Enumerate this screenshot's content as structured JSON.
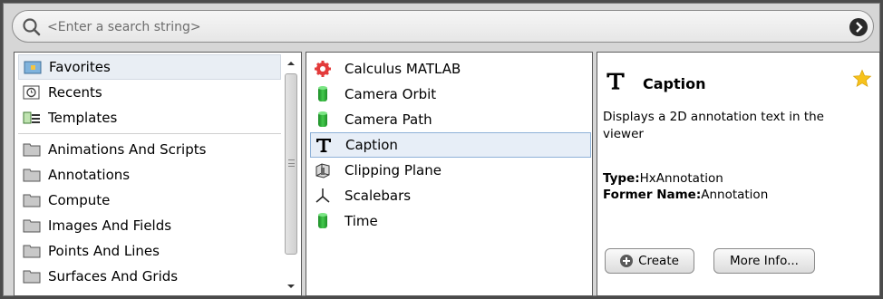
{
  "search": {
    "placeholder": "<Enter a search string>"
  },
  "categories": {
    "top": [
      {
        "label": "Favorites",
        "icon": "favorites-folder-icon"
      },
      {
        "label": "Recents",
        "icon": "recents-clock-icon"
      },
      {
        "label": "Templates",
        "icon": "templates-icon"
      }
    ],
    "folders": [
      {
        "label": "Animations And Scripts"
      },
      {
        "label": "Annotations"
      },
      {
        "label": "Compute"
      },
      {
        "label": "Images And Fields"
      },
      {
        "label": "Points And Lines"
      },
      {
        "label": "Surfaces And Grids"
      }
    ],
    "selected": "Favorites"
  },
  "modules": {
    "items": [
      {
        "label": "Calculus MATLAB",
        "icon": "matlab-gear-icon"
      },
      {
        "label": "Camera Orbit",
        "icon": "green-cylinder-icon"
      },
      {
        "label": "Camera Path",
        "icon": "green-cylinder-icon"
      },
      {
        "label": "Caption",
        "icon": "text-t-icon"
      },
      {
        "label": "Clipping Plane",
        "icon": "clipping-plane-icon"
      },
      {
        "label": "Scalebars",
        "icon": "axes-icon"
      },
      {
        "label": "Time",
        "icon": "green-cylinder-icon"
      }
    ],
    "selected": "Caption"
  },
  "info": {
    "title": "Caption",
    "description": "Displays a 2D annotation text in the viewer",
    "type_label": "Type:",
    "type_value": "HxAnnotation",
    "former_label": "Former Name:",
    "former_value": "Annotation",
    "favorite": true,
    "create_label": "Create",
    "more_info_label": "More Info..."
  },
  "colors": {
    "selection_border": "#8fb2d8",
    "star": "#f7c21c",
    "cylinder": "#2fae3a"
  }
}
